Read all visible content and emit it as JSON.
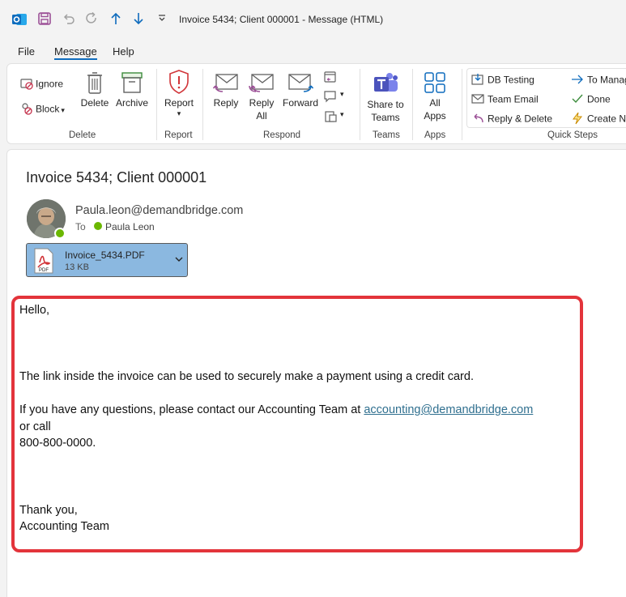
{
  "window": {
    "title": "Invoice 5434; Client 000001  -  Message (HTML)"
  },
  "menu": {
    "tabs": [
      "File",
      "Message",
      "Help"
    ]
  },
  "ribbon": {
    "delete_group": {
      "ignore": "Ignore",
      "block": "Block",
      "delete": "Delete",
      "archive": "Archive",
      "label": "Delete"
    },
    "report_group": {
      "report": "Report",
      "label": "Report"
    },
    "respond_group": {
      "reply": "Reply",
      "reply_all_1": "Reply",
      "reply_all_2": "All",
      "forward": "Forward",
      "label": "Respond"
    },
    "teams_group": {
      "share_1": "Share to",
      "share_2": "Teams",
      "label": "Teams"
    },
    "apps_group": {
      "all_1": "All",
      "all_2": "Apps",
      "label": "Apps"
    },
    "quick_steps": {
      "items": [
        "DB Testing",
        "Team Email",
        "Reply & Delete",
        "To Manag",
        "Done",
        "Create Ne"
      ],
      "label": "Quick Steps"
    }
  },
  "message": {
    "subject": "Invoice 5434; Client 000001",
    "sender": "Paula.leon@demandbridge.com",
    "to_label": "To",
    "to_name": "Paula Leon",
    "attachment": {
      "name": "Invoice_5434.PDF",
      "size": "13 KB",
      "icon_text": "PDF"
    },
    "body": {
      "greeting": "Hello,",
      "line1": "The link inside the invoice can be used to securely make a payment using a credit card.",
      "line2": "If you have any questions, please contact our Accounting Team at ",
      "link": "accounting@demandbridge.com",
      "line3": "or call",
      "line4": "800-800-0000.",
      "closing": "Thank you,",
      "signature": "Accounting Team"
    }
  },
  "colors": {
    "accent": "#0f6cbd",
    "highlight": "#e3343b",
    "attachment_bg": "#8bb8e0",
    "presence": "#6bb700"
  }
}
